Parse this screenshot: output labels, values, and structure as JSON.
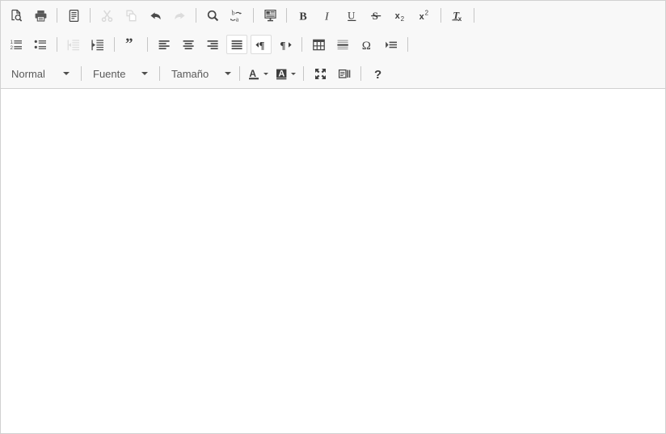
{
  "editor": {
    "name": "CKEditor",
    "language": "es",
    "background": "#ffffff",
    "toolbar_background": "#f8f8f8",
    "border_color": "#d1d1d1"
  },
  "toolbar": {
    "rows": [
      {
        "groups": [
          {
            "name": "document",
            "items": [
              {
                "name": "preview-icon",
                "label": "Vista previa",
                "icon": "preview",
                "state": "enabled"
              },
              {
                "name": "print-icon",
                "label": "Imprimir",
                "icon": "print",
                "state": "enabled"
              }
            ]
          },
          {
            "name": "templates",
            "items": [
              {
                "name": "templates-icon",
                "label": "Plantillas",
                "icon": "templates",
                "state": "enabled"
              }
            ]
          },
          {
            "name": "clipboard",
            "items": [
              {
                "name": "cut-icon",
                "label": "Cortar",
                "icon": "cut",
                "state": "disabled"
              },
              {
                "name": "copy-icon",
                "label": "Copiar",
                "icon": "copy",
                "state": "disabled"
              },
              {
                "name": "undo-icon",
                "label": "Deshacer",
                "icon": "undo",
                "state": "enabled"
              },
              {
                "name": "redo-icon",
                "label": "Rehacer",
                "icon": "redo",
                "state": "disabled"
              }
            ]
          },
          {
            "name": "editing",
            "items": [
              {
                "name": "find-icon",
                "label": "Buscar",
                "icon": "find",
                "state": "enabled"
              },
              {
                "name": "replace-icon",
                "label": "Reemplazar",
                "icon": "replace",
                "state": "enabled"
              }
            ]
          },
          {
            "name": "paste",
            "items": [
              {
                "name": "paste-from-word-icon",
                "label": "Pegar desde Word",
                "icon": "paste-word",
                "state": "enabled"
              }
            ]
          },
          {
            "name": "basic-styles",
            "items": [
              {
                "name": "bold-button",
                "label": "Negrita",
                "icon": "bold",
                "state": "enabled"
              },
              {
                "name": "italic-button",
                "label": "Cursiva",
                "icon": "italic",
                "state": "enabled"
              },
              {
                "name": "underline-button",
                "label": "Subrayado",
                "icon": "underline",
                "state": "enabled"
              },
              {
                "name": "strike-button",
                "label": "Tachado",
                "icon": "strike",
                "state": "enabled"
              },
              {
                "name": "subscript-button",
                "label": "Subíndice",
                "icon": "subscript",
                "state": "enabled"
              },
              {
                "name": "superscript-button",
                "label": "Superíndice",
                "icon": "superscript",
                "state": "enabled"
              }
            ]
          },
          {
            "name": "remove-format",
            "items": [
              {
                "name": "remove-format-icon",
                "label": "Eliminar formato",
                "icon": "remove-format",
                "state": "enabled"
              }
            ]
          }
        ]
      },
      {
        "groups": [
          {
            "name": "lists",
            "items": [
              {
                "name": "numbered-list-icon",
                "label": "Lista numerada",
                "icon": "numlist",
                "state": "enabled"
              },
              {
                "name": "bulleted-list-icon",
                "label": "Lista de viñetas",
                "icon": "bullist",
                "state": "enabled"
              }
            ]
          },
          {
            "name": "indent",
            "items": [
              {
                "name": "outdent-icon",
                "label": "Reducir sangría",
                "icon": "outdent",
                "state": "disabled"
              },
              {
                "name": "indent-icon",
                "label": "Aumentar sangría",
                "icon": "indent",
                "state": "enabled"
              }
            ]
          },
          {
            "name": "blockquote",
            "items": [
              {
                "name": "blockquote-icon",
                "label": "Cita",
                "icon": "quote",
                "state": "enabled"
              }
            ]
          },
          {
            "name": "alignment",
            "items": [
              {
                "name": "align-left-icon",
                "label": "Alinear a la izquierda",
                "icon": "align-left",
                "state": "enabled"
              },
              {
                "name": "align-center-icon",
                "label": "Centrar",
                "icon": "align-center",
                "state": "enabled"
              },
              {
                "name": "align-right-icon",
                "label": "Alinear a la derecha",
                "icon": "align-right",
                "state": "enabled"
              },
              {
                "name": "align-justify-icon",
                "label": "Justificado",
                "icon": "align-justify",
                "state": "active"
              }
            ]
          },
          {
            "name": "direction",
            "items": [
              {
                "name": "text-direction-ltr-icon",
                "label": "Dirección del texto de izquierda a derecha",
                "icon": "ltr",
                "state": "active"
              },
              {
                "name": "text-direction-rtl-icon",
                "label": "Dirección del texto de derecha a izquierda",
                "icon": "rtl",
                "state": "enabled"
              }
            ]
          },
          {
            "name": "insert",
            "items": [
              {
                "name": "table-icon",
                "label": "Tabla",
                "icon": "table",
                "state": "enabled"
              },
              {
                "name": "horizontal-rule-icon",
                "label": "Línea horizontal",
                "icon": "hrule",
                "state": "enabled"
              },
              {
                "name": "special-character-icon",
                "label": "Carácter especial",
                "icon": "omega",
                "state": "enabled"
              },
              {
                "name": "page-break-icon",
                "label": "Salto de página",
                "icon": "pagebreak",
                "state": "enabled"
              }
            ]
          }
        ]
      },
      {
        "groups": [
          {
            "name": "styles",
            "combos": [
              {
                "name": "paragraph-format-dropdown",
                "label": "Normal",
                "width": "w-normal"
              },
              {
                "name": "font-family-dropdown",
                "label": "Fuente",
                "width": "w-fuente"
              },
              {
                "name": "font-size-dropdown",
                "label": "Tamaño",
                "width": "w-tamano"
              }
            ]
          },
          {
            "name": "colors",
            "items": [
              {
                "name": "text-color-button",
                "label": "Color de texto",
                "icon": "text-color",
                "state": "enabled"
              },
              {
                "name": "background-color-button",
                "label": "Color de fondo",
                "icon": "bg-color",
                "state": "enabled"
              }
            ]
          },
          {
            "name": "tools",
            "items": [
              {
                "name": "maximize-icon",
                "label": "Maximizar",
                "icon": "maximize",
                "state": "enabled"
              },
              {
                "name": "show-blocks-icon",
                "label": "Mostrar bloques",
                "icon": "show-blocks",
                "state": "enabled"
              }
            ]
          },
          {
            "name": "about",
            "items": [
              {
                "name": "help-icon",
                "label": "Acerca de CKEditor",
                "icon": "help",
                "state": "enabled"
              }
            ]
          }
        ]
      }
    ]
  },
  "content": {
    "body_text": "",
    "placeholder": ""
  }
}
